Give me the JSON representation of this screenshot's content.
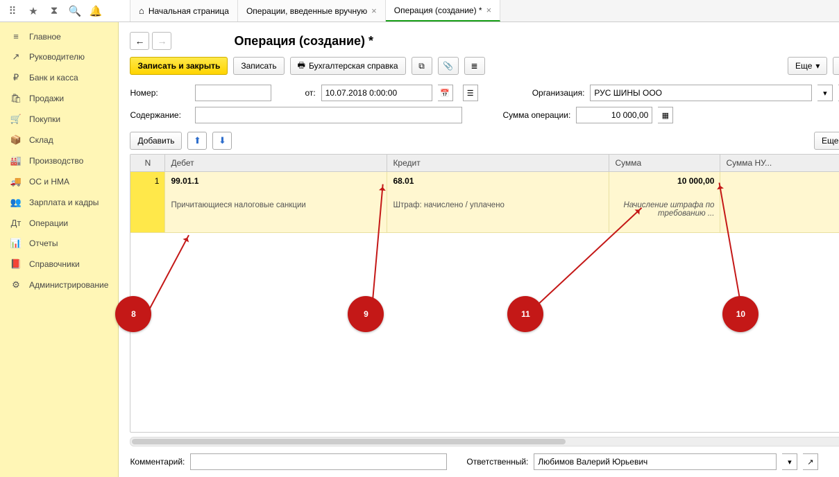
{
  "tabs": [
    {
      "label": "Начальная страница"
    },
    {
      "label": "Операции, введенные вручную"
    },
    {
      "label": "Операция (создание) *",
      "active": true
    }
  ],
  "sidebar": [
    {
      "icon": "menu-icon",
      "glyph": "≡",
      "label": "Главное"
    },
    {
      "icon": "chart-icon",
      "glyph": "↗",
      "label": "Руководителю"
    },
    {
      "icon": "ruble-icon",
      "glyph": "₽",
      "label": "Банк и касса"
    },
    {
      "icon": "bag-icon",
      "glyph": "🛍",
      "label": "Продажи"
    },
    {
      "icon": "cart-icon",
      "glyph": "🛒",
      "label": "Покупки"
    },
    {
      "icon": "box-icon",
      "glyph": "📦",
      "label": "Склад"
    },
    {
      "icon": "factory-icon",
      "glyph": "🏭",
      "label": "Производство"
    },
    {
      "icon": "truck-icon",
      "glyph": "🚚",
      "label": "ОС и НМА"
    },
    {
      "icon": "people-icon",
      "glyph": "👥",
      "label": "Зарплата и кадры"
    },
    {
      "icon": "ops-icon",
      "glyph": "Дт",
      "label": "Операции"
    },
    {
      "icon": "report-icon",
      "glyph": "📊",
      "label": "Отчеты"
    },
    {
      "icon": "book-icon",
      "glyph": "📕",
      "label": "Справочники"
    },
    {
      "icon": "gear-icon",
      "glyph": "⚙",
      "label": "Администрирование"
    }
  ],
  "page": {
    "title": "Операция (создание) *",
    "save_close": "Записать и закрыть",
    "save": "Записать",
    "print": "Бухгалтерская справка",
    "more": "Еще",
    "help": "?",
    "number_lbl": "Номер:",
    "from_lbl": "от:",
    "date_value": "10.07.2018 0:00:00",
    "org_lbl": "Организация:",
    "org_value": "РУС ШИНЫ ООО",
    "content_lbl": "Содержание:",
    "sum_lbl": "Сумма операции:",
    "sum_value": "10 000,00",
    "add": "Добавить"
  },
  "table": {
    "headers": {
      "n": "N",
      "debit": "Дебет",
      "credit": "Кредит",
      "sum": "Сумма",
      "sumnu": "Сумма НУ..."
    },
    "rows": [
      {
        "n": "1",
        "debit_acct": "99.01.1",
        "debit_desc": "Причитающиеся налоговые санкции",
        "credit_acct": "68.01",
        "credit_desc": "Штраф: начислено / уплачено",
        "sum": "10 000,00",
        "sum_desc": "Начисление штрафа по требованию ..."
      }
    ]
  },
  "footer": {
    "comment_lbl": "Комментарий:",
    "resp_lbl": "Ответственный:",
    "resp_value": "Любимов Валерий Юрьевич"
  },
  "callouts": {
    "c8": "8",
    "c9": "9",
    "c10": "10",
    "c11": "11"
  }
}
